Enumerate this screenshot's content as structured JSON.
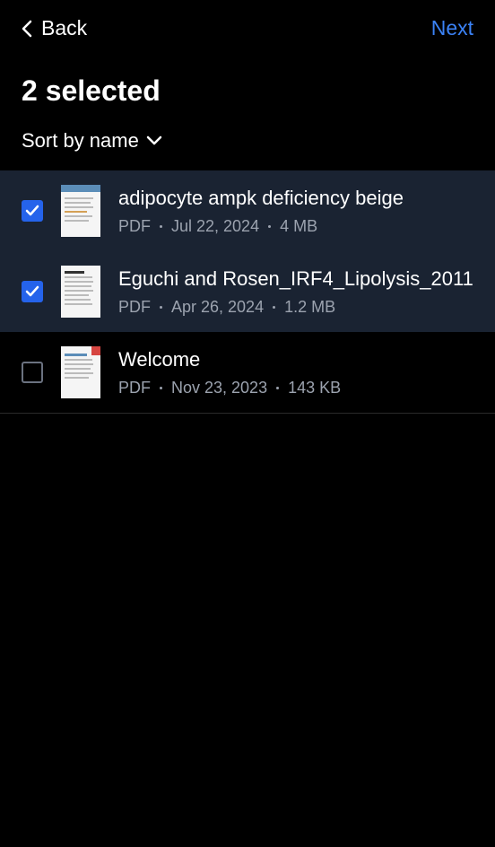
{
  "header": {
    "back_label": "Back",
    "next_label": "Next"
  },
  "title": "2 selected",
  "sort": {
    "label": "Sort by name"
  },
  "files": [
    {
      "name": "adipocyte ampk deficiency beige",
      "type": "PDF",
      "date": "Jul 22, 2024",
      "size": "4 MB",
      "selected": true
    },
    {
      "name": "Eguchi and Rosen_IRF4_Lipolysis_2011",
      "type": "PDF",
      "date": "Apr 26, 2024",
      "size": "1.2 MB",
      "selected": true
    },
    {
      "name": "Welcome",
      "type": "PDF",
      "date": "Nov 23, 2023",
      "size": "143 KB",
      "selected": false
    }
  ]
}
